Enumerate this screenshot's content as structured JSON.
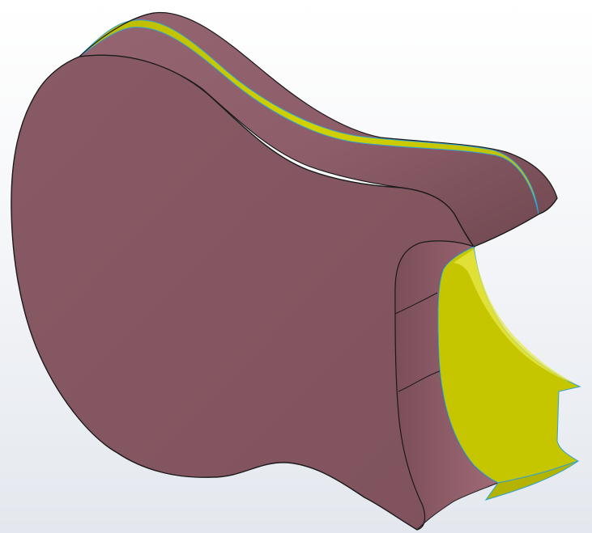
{
  "viewport": {
    "model": "guitar-body",
    "background_top": "#ffffff",
    "background_bottom": "#e4e8ee"
  },
  "colors": {
    "body_face": "#845661",
    "body_side": "#936470",
    "body_side_dark": "#6e454f",
    "binding_yellow": "#c6c600",
    "binding_highlight": "#e8e84a",
    "edge_line": "#1a1a1a",
    "selection_edge": "#2ea3d6"
  }
}
